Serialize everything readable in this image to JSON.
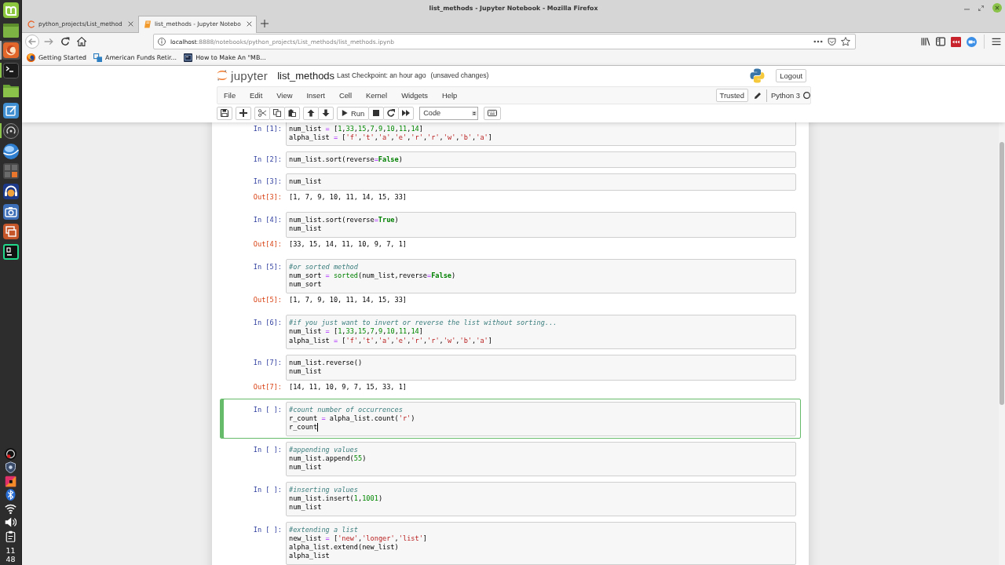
{
  "taskbar": {
    "launchers": [
      {
        "running": false,
        "selected": false
      },
      {
        "running": false,
        "selected": false
      },
      {
        "running": true,
        "selected": true
      },
      {
        "running": true,
        "selected": false
      },
      {
        "running": false,
        "selected": false
      },
      {
        "running": false,
        "selected": false
      },
      {
        "running": true,
        "selected": false
      },
      {
        "running": false,
        "selected": false
      },
      {
        "running": false,
        "selected": false
      },
      {
        "running": false,
        "selected": false
      },
      {
        "running": false,
        "selected": false
      },
      {
        "running": false,
        "selected": false
      },
      {
        "running": false,
        "selected": false
      }
    ],
    "clock": {
      "hour": "11",
      "minute": "48"
    }
  },
  "window": {
    "title": "list_methods - Jupyter Notebook - Mozilla Firefox"
  },
  "browser": {
    "tabs": [
      {
        "label": "python_projects/List_method",
        "selected": false
      },
      {
        "label": "list_methods - Jupyter Notebo",
        "selected": true
      }
    ],
    "url": {
      "host": "localhost",
      "path": ":8888/notebooks/python_projects/List_methods/list_methods.ipynb"
    },
    "bookmarks": [
      "Getting Started",
      "American Funds Retir...",
      "How to Make An \"MB..."
    ]
  },
  "notebook": {
    "logo_text": "jupyter",
    "name": "list_methods",
    "checkpoint": "Last Checkpoint: an hour ago",
    "save_status": "(unsaved changes)",
    "logout": "Logout",
    "menu": [
      "File",
      "Edit",
      "View",
      "Insert",
      "Cell",
      "Kernel",
      "Widgets",
      "Help"
    ],
    "trusted": "Trusted",
    "kernel": "Python 3",
    "toolbar": {
      "run": "Run",
      "cell_type": "Code"
    },
    "cells": [
      {
        "prompt": "In [1]:",
        "selected": false,
        "lines": [
          [
            {
              "text": "num_list ",
              "kind": "plain"
            },
            {
              "text": "=",
              "kind": "operator"
            },
            {
              "text": " [",
              "kind": "plain"
            },
            {
              "text": "1",
              "kind": "number"
            },
            {
              "text": ",",
              "kind": "plain"
            },
            {
              "text": "33",
              "kind": "number"
            },
            {
              "text": ",",
              "kind": "plain"
            },
            {
              "text": "15",
              "kind": "number"
            },
            {
              "text": ",",
              "kind": "plain"
            },
            {
              "text": "7",
              "kind": "number"
            },
            {
              "text": ",",
              "kind": "plain"
            },
            {
              "text": "9",
              "kind": "number"
            },
            {
              "text": ",",
              "kind": "plain"
            },
            {
              "text": "10",
              "kind": "number"
            },
            {
              "text": ",",
              "kind": "plain"
            },
            {
              "text": "11",
              "kind": "number"
            },
            {
              "text": ",",
              "kind": "plain"
            },
            {
              "text": "14",
              "kind": "number"
            },
            {
              "text": "]",
              "kind": "plain"
            }
          ],
          [
            {
              "text": "alpha_list ",
              "kind": "plain"
            },
            {
              "text": "=",
              "kind": "operator"
            },
            {
              "text": " [",
              "kind": "plain"
            },
            {
              "text": "'f'",
              "kind": "string"
            },
            {
              "text": ",",
              "kind": "plain"
            },
            {
              "text": "'t'",
              "kind": "string"
            },
            {
              "text": ",",
              "kind": "plain"
            },
            {
              "text": "'a'",
              "kind": "string"
            },
            {
              "text": ",",
              "kind": "plain"
            },
            {
              "text": "'e'",
              "kind": "string"
            },
            {
              "text": ",",
              "kind": "plain"
            },
            {
              "text": "'r'",
              "kind": "string"
            },
            {
              "text": ",",
              "kind": "plain"
            },
            {
              "text": "'r'",
              "kind": "string"
            },
            {
              "text": ",",
              "kind": "plain"
            },
            {
              "text": "'w'",
              "kind": "string"
            },
            {
              "text": ",",
              "kind": "plain"
            },
            {
              "text": "'b'",
              "kind": "string"
            },
            {
              "text": ",",
              "kind": "plain"
            },
            {
              "text": "'a'",
              "kind": "string"
            },
            {
              "text": "]",
              "kind": "plain"
            }
          ]
        ]
      },
      {
        "prompt": "In [2]:",
        "selected": false,
        "lines": [
          [
            {
              "text": "num_list.sort(reverse",
              "kind": "plain"
            },
            {
              "text": "=",
              "kind": "operator"
            },
            {
              "text": "False",
              "kind": "keyword"
            },
            {
              "text": ")",
              "kind": "plain"
            }
          ]
        ]
      },
      {
        "prompt": "In [3]:",
        "selected": false,
        "lines": [
          [
            {
              "text": "num_list",
              "kind": "plain"
            }
          ]
        ],
        "output": {
          "prompt": "Out[3]:",
          "text": "[1, 7, 9, 10, 11, 14, 15, 33]"
        }
      },
      {
        "prompt": "In [4]:",
        "selected": false,
        "lines": [
          [
            {
              "text": "num_list.sort(reverse",
              "kind": "plain"
            },
            {
              "text": "=",
              "kind": "operator"
            },
            {
              "text": "True",
              "kind": "keyword"
            },
            {
              "text": ")",
              "kind": "plain"
            }
          ],
          [
            {
              "text": "num_list",
              "kind": "plain"
            }
          ]
        ],
        "output": {
          "prompt": "Out[4]:",
          "text": "[33, 15, 14, 11, 10, 9, 7, 1]"
        }
      },
      {
        "prompt": "In [5]:",
        "selected": false,
        "lines": [
          [
            {
              "text": "#or sorted method",
              "kind": "comment"
            }
          ],
          [
            {
              "text": "num_sort ",
              "kind": "plain"
            },
            {
              "text": "= ",
              "kind": "operator"
            },
            {
              "text": "sorted",
              "kind": "builtin"
            },
            {
              "text": "(num_list,reverse",
              "kind": "plain"
            },
            {
              "text": "=",
              "kind": "operator"
            },
            {
              "text": "False",
              "kind": "keyword"
            },
            {
              "text": ")",
              "kind": "plain"
            }
          ],
          [
            {
              "text": "num_sort",
              "kind": "plain"
            }
          ]
        ],
        "output": {
          "prompt": "Out[5]:",
          "text": "[1, 7, 9, 10, 11, 14, 15, 33]"
        }
      },
      {
        "prompt": "In [6]:",
        "selected": false,
        "lines": [
          [
            {
              "text": "#if you just want to invert or reverse the list without sorting...",
              "kind": "comment"
            }
          ],
          [
            {
              "text": "num_list ",
              "kind": "plain"
            },
            {
              "text": "=",
              "kind": "operator"
            },
            {
              "text": " [",
              "kind": "plain"
            },
            {
              "text": "1",
              "kind": "number"
            },
            {
              "text": ",",
              "kind": "plain"
            },
            {
              "text": "33",
              "kind": "number"
            },
            {
              "text": ",",
              "kind": "plain"
            },
            {
              "text": "15",
              "kind": "number"
            },
            {
              "text": ",",
              "kind": "plain"
            },
            {
              "text": "7",
              "kind": "number"
            },
            {
              "text": ",",
              "kind": "plain"
            },
            {
              "text": "9",
              "kind": "number"
            },
            {
              "text": ",",
              "kind": "plain"
            },
            {
              "text": "10",
              "kind": "number"
            },
            {
              "text": ",",
              "kind": "plain"
            },
            {
              "text": "11",
              "kind": "number"
            },
            {
              "text": ",",
              "kind": "plain"
            },
            {
              "text": "14",
              "kind": "number"
            },
            {
              "text": "]",
              "kind": "plain"
            }
          ],
          [
            {
              "text": "alpha_list ",
              "kind": "plain"
            },
            {
              "text": "=",
              "kind": "operator"
            },
            {
              "text": " [",
              "kind": "plain"
            },
            {
              "text": "'f'",
              "kind": "string"
            },
            {
              "text": ",",
              "kind": "plain"
            },
            {
              "text": "'t'",
              "kind": "string"
            },
            {
              "text": ",",
              "kind": "plain"
            },
            {
              "text": "'a'",
              "kind": "string"
            },
            {
              "text": ",",
              "kind": "plain"
            },
            {
              "text": "'e'",
              "kind": "string"
            },
            {
              "text": ",",
              "kind": "plain"
            },
            {
              "text": "'r'",
              "kind": "string"
            },
            {
              "text": ",",
              "kind": "plain"
            },
            {
              "text": "'r'",
              "kind": "string"
            },
            {
              "text": ",",
              "kind": "plain"
            },
            {
              "text": "'w'",
              "kind": "string"
            },
            {
              "text": ",",
              "kind": "plain"
            },
            {
              "text": "'b'",
              "kind": "string"
            },
            {
              "text": ",",
              "kind": "plain"
            },
            {
              "text": "'a'",
              "kind": "string"
            },
            {
              "text": "]",
              "kind": "plain"
            }
          ]
        ]
      },
      {
        "prompt": "In [7]:",
        "selected": false,
        "lines": [
          [
            {
              "text": "num_list.reverse()",
              "kind": "plain"
            }
          ],
          [
            {
              "text": "num_list",
              "kind": "plain"
            }
          ]
        ],
        "output": {
          "prompt": "Out[7]:",
          "text": "[14, 11, 10, 9, 7, 15, 33, 1]"
        }
      },
      {
        "prompt": "In [ ]:",
        "selected": true,
        "lines": [
          [
            {
              "text": "#count number of occurrences",
              "kind": "comment"
            }
          ],
          [
            {
              "text": "r_count ",
              "kind": "plain"
            },
            {
              "text": "=",
              "kind": "operator"
            },
            {
              "text": " alpha_list.count(",
              "kind": "plain"
            },
            {
              "text": "'r'",
              "kind": "string"
            },
            {
              "text": ")",
              "kind": "plain"
            }
          ],
          [
            {
              "text": "r_count",
              "kind": "plain"
            }
          ]
        ]
      },
      {
        "prompt": "In [ ]:",
        "selected": false,
        "lines": [
          [
            {
              "text": "#appending values",
              "kind": "comment"
            }
          ],
          [
            {
              "text": "num_list.append(",
              "kind": "plain"
            },
            {
              "text": "55",
              "kind": "number"
            },
            {
              "text": ")",
              "kind": "plain"
            }
          ],
          [
            {
              "text": "num_list",
              "kind": "plain"
            }
          ]
        ]
      },
      {
        "prompt": "In [ ]:",
        "selected": false,
        "lines": [
          [
            {
              "text": "#inserting values",
              "kind": "comment"
            }
          ],
          [
            {
              "text": "num_list.insert(",
              "kind": "plain"
            },
            {
              "text": "1",
              "kind": "number"
            },
            {
              "text": ",",
              "kind": "plain"
            },
            {
              "text": "1001",
              "kind": "number"
            },
            {
              "text": ")",
              "kind": "plain"
            }
          ],
          [
            {
              "text": "num_list",
              "kind": "plain"
            }
          ]
        ]
      },
      {
        "prompt": "In [ ]:",
        "selected": false,
        "lines": [
          [
            {
              "text": "#extending a list",
              "kind": "comment"
            }
          ],
          [
            {
              "text": "new_list ",
              "kind": "plain"
            },
            {
              "text": "=",
              "kind": "operator"
            },
            {
              "text": " [",
              "kind": "plain"
            },
            {
              "text": "'new'",
              "kind": "string"
            },
            {
              "text": ",",
              "kind": "plain"
            },
            {
              "text": "'longer'",
              "kind": "string"
            },
            {
              "text": ",",
              "kind": "plain"
            },
            {
              "text": "'list'",
              "kind": "string"
            },
            {
              "text": "]",
              "kind": "plain"
            }
          ],
          [
            {
              "text": "alpha_list.extend(new_list)",
              "kind": "plain"
            }
          ],
          [
            {
              "text": "alpha_list",
              "kind": "plain"
            }
          ]
        ]
      }
    ]
  }
}
